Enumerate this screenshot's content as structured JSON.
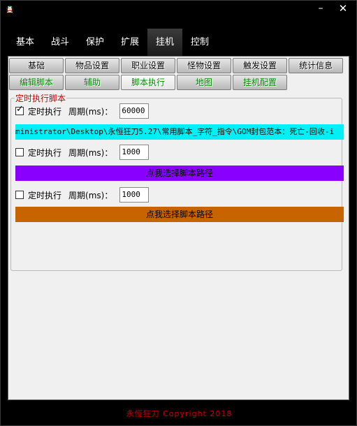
{
  "window": {
    "minimize_label": "–",
    "close_label": "✕",
    "icon": "penguin-icon"
  },
  "main_tabs": [
    "基本",
    "战斗",
    "保护",
    "扩展",
    "挂机",
    "控制"
  ],
  "main_tab_active": "挂机",
  "subtabs_row1": [
    "基础",
    "物品设置",
    "职业设置",
    "怪物设置",
    "触发设置",
    "统计信息"
  ],
  "subtabs_row2": [
    "编辑脚本",
    "辅助",
    "脚本执行",
    "地图",
    "挂机配置"
  ],
  "subtab_active": "脚本执行",
  "group": {
    "title": "定时执行脚本"
  },
  "timers": [
    {
      "checked": true,
      "check_mark": "✓",
      "label": "定时执行",
      "period_label": "周期(ms)：",
      "period": "60000"
    },
    {
      "checked": false,
      "check_mark": "",
      "label": "定时执行",
      "period_label": "周期(ms)：",
      "period": "1000"
    },
    {
      "checked": false,
      "check_mark": "",
      "label": "定时执行",
      "period_label": "周期(ms)：",
      "period": "1000"
    }
  ],
  "paths": [
    {
      "text": "ministrator\\Desktop\\永恒狂刀5.27\\常用脚本_字符_指令\\GOM封包范本：死亡-回收-i",
      "color": "#00f0f5"
    },
    {
      "text": "点我选择脚本路径",
      "color": "#8a00ff"
    },
    {
      "text": "点我选择脚本路径",
      "color": "#c86400"
    }
  ],
  "footer": "永恒狂刀  Copyright 2018"
}
